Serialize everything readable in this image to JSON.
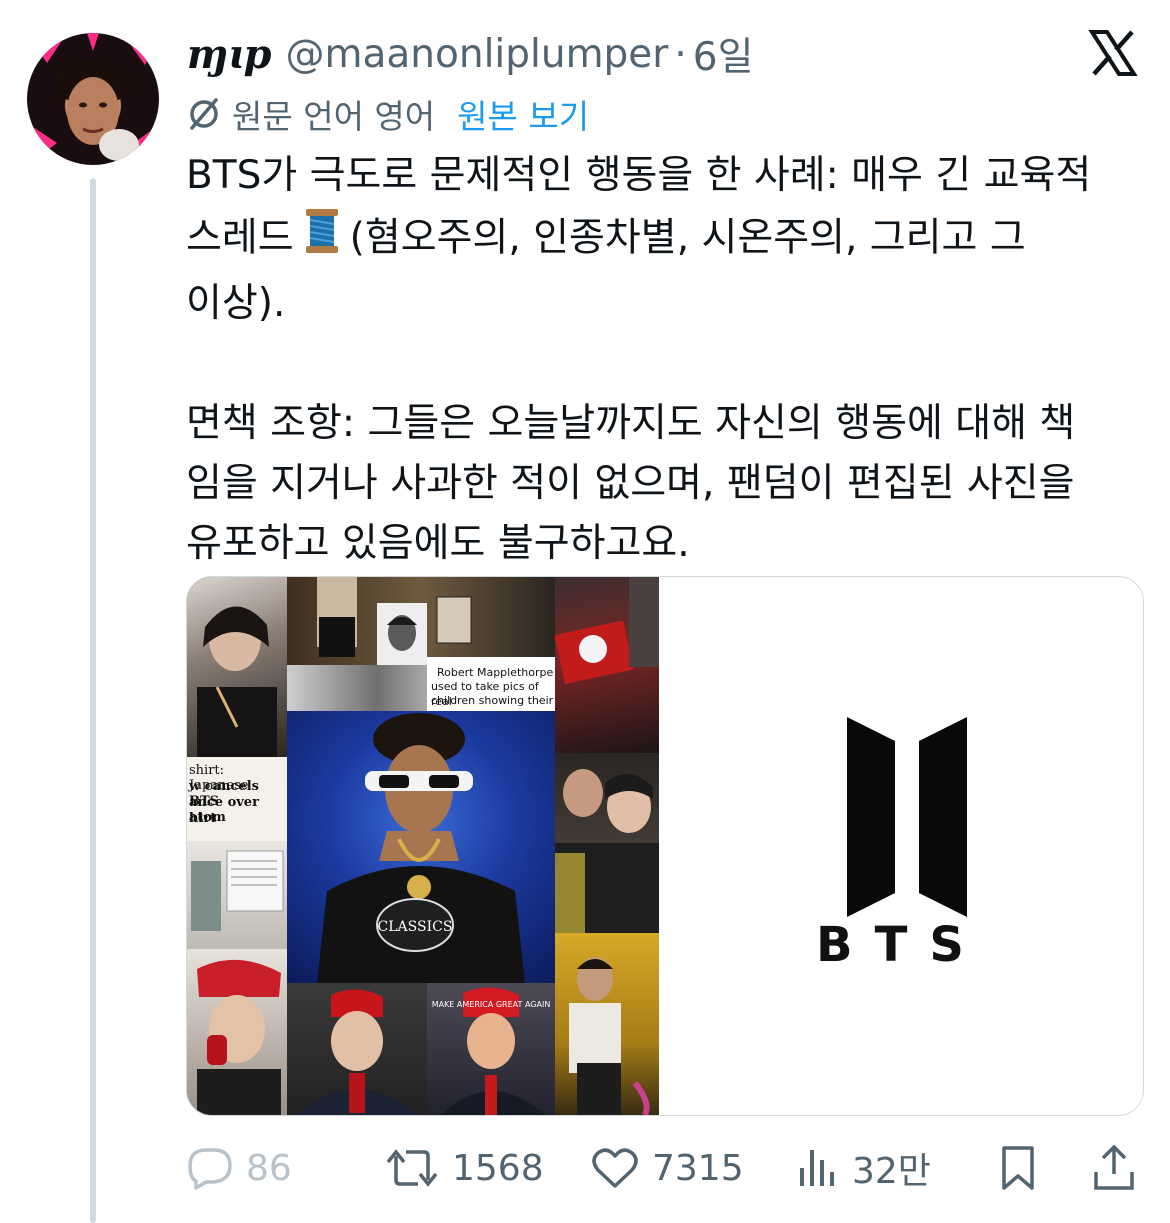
{
  "tweet": {
    "display_name": "ɱɩp",
    "handle": "@maanonliplumper",
    "separator": "·",
    "time": "6일",
    "translation_note": "원문 언어 영어",
    "translation_link": "원본 보기",
    "text_line1": "BTS가 극도로 문제적인 행동을 한 사례: 매우 긴 교육적",
    "text_line2_a": "스레드",
    "text_line2_b": "(혐오주의, 인종차별, 시온주의, 그리고 그",
    "text_line3": "이상).",
    "text_line4": "면책 조항: 그들은 오늘날까지도 자신의 행동에 대해 책",
    "text_line5": "임을 지거나 사과한 적이 없으며, 팬덤이 편집된 사진을",
    "text_line6": "유포하고 있음에도 불구하고요."
  },
  "media": {
    "logo_text": "BTS",
    "caption_robert_1": "Robert Mapplethorpe",
    "caption_robert_2": "used to take pics of real",
    "caption_robert_3": "children showing their",
    "caption_news_1": "shirt: Japanese",
    "caption_news_2": "w cancels BTS",
    "caption_news_3": "ance over atom",
    "caption_news_4": "hirt",
    "shirt_text": "CLASSICS",
    "hat_text": "MAKE AMERICA GREAT AGAIN"
  },
  "actions": {
    "replies": "86",
    "reposts": "1568",
    "likes": "7315",
    "views": "32만"
  },
  "colors": {
    "link": "#1d9bf0",
    "secondary_text": "#536471",
    "thread_line": "#cfd9de"
  }
}
